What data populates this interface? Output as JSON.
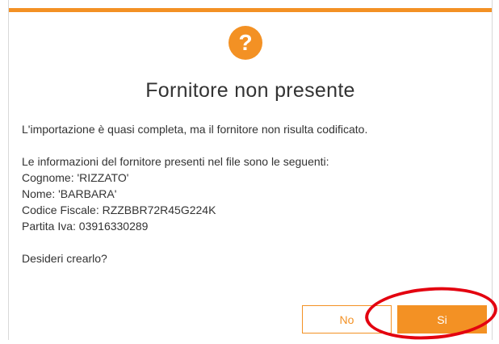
{
  "dialog": {
    "title": "Fornitore non presente",
    "icon": "question-icon",
    "accent_color": "#f39124",
    "intro": "L'importazione è quasi completa, ma il fornitore non risulta codificato.",
    "info_header": "Le informazioni del fornitore presenti nel file sono le seguenti:",
    "cognome": "Cognome: 'RIZZATO'",
    "nome": "Nome: 'BARBARA'",
    "codice_fiscale": "Codice Fiscale: RZZBBR72R45G224K",
    "partita_iva": "Partita Iva: 03916330289",
    "question": "Desideri crearlo?",
    "buttons": {
      "no_label": "No",
      "si_label": "Si"
    }
  },
  "annotation_color": "#e3000f"
}
